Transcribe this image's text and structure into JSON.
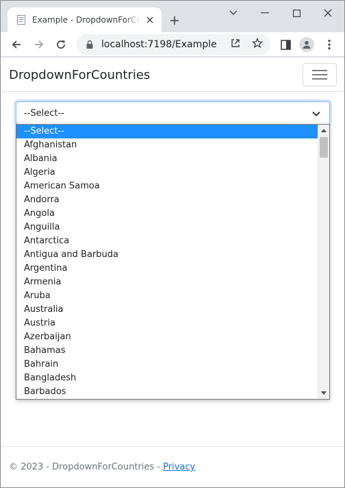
{
  "browser": {
    "tab_title": "Example - DropdownForCountries",
    "url": "localhost:7198/Example"
  },
  "page": {
    "brand": "DropdownForCountries",
    "select": {
      "selected": "--Select--",
      "options": [
        "--Select--",
        "Afghanistan",
        "Albania",
        "Algeria",
        "American Samoa",
        "Andorra",
        "Angola",
        "Anguilla",
        "Antarctica",
        "Antigua and Barbuda",
        "Argentina",
        "Armenia",
        "Aruba",
        "Australia",
        "Austria",
        "Azerbaijan",
        "Bahamas",
        "Bahrain",
        "Bangladesh",
        "Barbados"
      ],
      "highlighted_index": 0
    },
    "footer": {
      "prefix": "© 2023 - DropdownForCountries - ",
      "privacy_link": "Privacy"
    }
  },
  "icons": {
    "favicon": "page-icon",
    "tab_close": "close-icon",
    "new_tab": "plus-icon",
    "back": "arrow-left-icon",
    "forward": "arrow-right-icon",
    "reload": "reload-icon",
    "lock": "lock-icon",
    "share": "share-icon",
    "bookmark": "star-icon",
    "side_panel": "side-panel-icon",
    "profile": "profile-icon",
    "menu": "kebab-menu-icon",
    "hamburger": "hamburger-icon"
  },
  "colors": {
    "highlight": "#1e90ff",
    "link": "#0d6efd",
    "focus_border": "#86b7fe"
  }
}
